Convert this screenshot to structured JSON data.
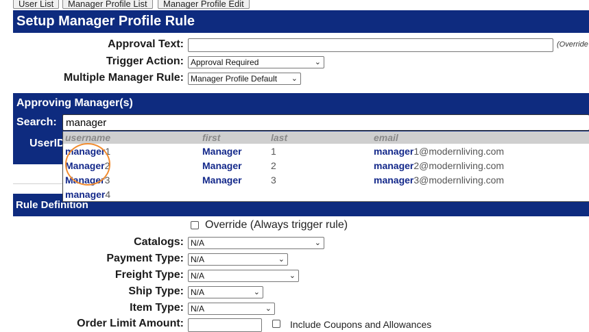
{
  "tabs": [
    "User List",
    "Manager Profile List",
    "Manager Profile Edit"
  ],
  "page_title": "Setup Manager Profile Rule",
  "approval_text": {
    "label": "Approval Text:",
    "value": "",
    "hint": "(Override"
  },
  "trigger_action": {
    "label": "Trigger Action:",
    "value": "Approval Required"
  },
  "multiple_manager_rule": {
    "label": "Multiple Manager Rule:",
    "value": "Manager Profile Default"
  },
  "approving_section": {
    "title": "Approving Manager(s)",
    "search_label": "Search:",
    "search_value": "manager",
    "userid_label": "UserID"
  },
  "autocomplete": {
    "columns": [
      "username",
      "first",
      "last",
      "email"
    ],
    "rows": [
      {
        "username_match": "manager",
        "username_rest": "1",
        "first": "Manager",
        "last": "1",
        "email_match": "manager",
        "email_rest": "1@modernliving.com"
      },
      {
        "username_match": "Manager",
        "username_rest": "2",
        "first": "Manager",
        "last": "2",
        "email_match": "manager",
        "email_rest": "2@modernliving.com"
      },
      {
        "username_match": "Manager",
        "username_rest": "3",
        "first": "Manager",
        "last": "3",
        "email_match": "manager",
        "email_rest": "3@modernliving.com"
      },
      {
        "username_match": "manager",
        "username_rest": "4",
        "first": "",
        "last": "",
        "email_match": "",
        "email_rest": ""
      }
    ]
  },
  "rule_section": {
    "title": "Rule Definition"
  },
  "override": {
    "label": "Override (Always trigger rule)",
    "checked": false
  },
  "catalogs": {
    "label": "Catalogs:",
    "value": "N/A"
  },
  "payment_type": {
    "label": "Payment Type:",
    "value": "N/A"
  },
  "freight_type": {
    "label": "Freight Type:",
    "value": "N/A"
  },
  "ship_type": {
    "label": "Ship Type:",
    "value": "N/A"
  },
  "item_type": {
    "label": "Item Type:",
    "value": "N/A"
  },
  "order_limit": {
    "label": "Order Limit Amount:",
    "value": "",
    "include_label": "Include Coupons and Allowances"
  },
  "colors": {
    "header_blue": "#0e2b7f",
    "match_blue": "#13288a",
    "highlight_orange": "#f28b2d"
  }
}
